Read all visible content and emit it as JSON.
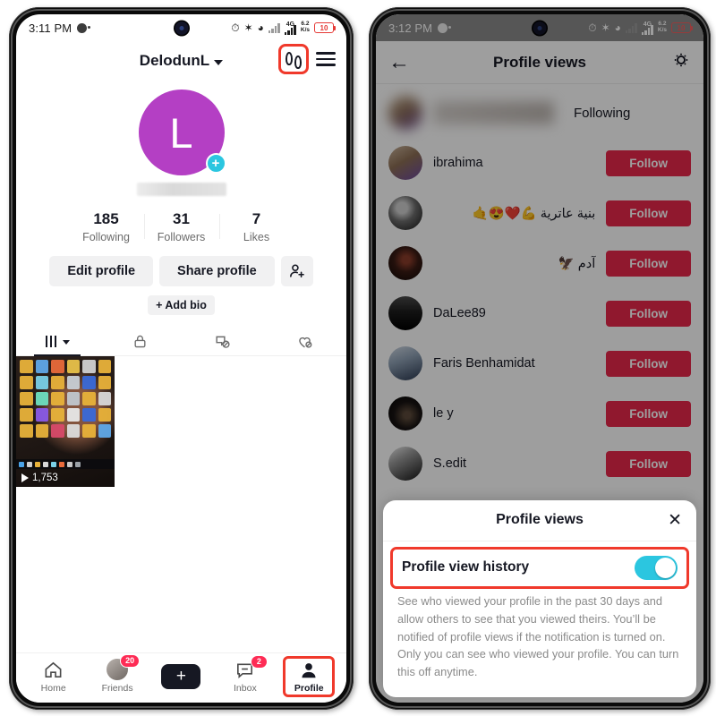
{
  "left_phone": {
    "status_bar": {
      "time": "3:11 PM",
      "alarm_icon": "alarm-icon",
      "bluetooth_icon": "bluetooth-icon",
      "hotspot_icon": "hotspot-icon",
      "network_type": "4G",
      "speed_value": "6.2",
      "speed_unit": "K/s",
      "battery": "10"
    },
    "header": {
      "username": "DelodunL",
      "dropdown_icon": "chevron-down-icon",
      "footprints_icon": "footprints-icon",
      "menu_icon": "hamburger-menu-icon"
    },
    "profile": {
      "avatar_letter": "L",
      "avatar_color": "#b43fc4",
      "add_story_icon": "plus-circle-icon",
      "handle_redacted": true,
      "stats": [
        {
          "num": "185",
          "label": "Following"
        },
        {
          "num": "31",
          "label": "Followers"
        },
        {
          "num": "7",
          "label": "Likes"
        }
      ],
      "edit_profile_label": "Edit profile",
      "share_profile_label": "Share profile",
      "add_friends_icon": "add-person-icon",
      "add_bio_label": "+ Add bio"
    },
    "content_tabs": [
      {
        "icon": "grid-videos-icon",
        "active": true
      },
      {
        "icon": "lock-private-icon",
        "active": false
      },
      {
        "icon": "repost-disabled-icon",
        "active": false
      },
      {
        "icon": "liked-hidden-icon",
        "active": false
      }
    ],
    "video": {
      "plays": "1,753",
      "play_icon": "play-icon"
    },
    "bottom_nav": [
      {
        "label": "Home",
        "icon": "home-icon",
        "badge": "",
        "active": false,
        "highlighted": false
      },
      {
        "label": "Friends",
        "icon": "friends-avatar-icon",
        "badge": "20",
        "active": false,
        "highlighted": false
      },
      {
        "label": "",
        "icon": "create-plus-icon",
        "badge": "",
        "active": false,
        "highlighted": false
      },
      {
        "label": "Inbox",
        "icon": "inbox-icon",
        "badge": "2",
        "active": false,
        "highlighted": false
      },
      {
        "label": "Profile",
        "icon": "profile-person-icon",
        "badge": "",
        "active": true,
        "highlighted": true
      }
    ]
  },
  "right_phone": {
    "status_bar": {
      "time": "3:12 PM",
      "network_type": "4G",
      "speed_value": "6.2",
      "speed_unit": "K/s",
      "battery": "10"
    },
    "header": {
      "back_icon": "arrow-left-icon",
      "title": "Profile views",
      "settings_icon": "gear-icon"
    },
    "viewers": [
      {
        "name": "",
        "redacted": true,
        "action": "Following",
        "action_type": "following",
        "avatar": "av1"
      },
      {
        "name": "ibrahima",
        "redacted": false,
        "action": "Follow",
        "action_type": "follow",
        "avatar": "av1",
        "rtl": false
      },
      {
        "name": "بنية عاترية 💪❤️😍🤙",
        "redacted": false,
        "action": "Follow",
        "action_type": "follow",
        "avatar": "av2",
        "rtl": true
      },
      {
        "name": "آدم 🦅",
        "redacted": false,
        "action": "Follow",
        "action_type": "follow",
        "avatar": "av3",
        "rtl": true
      },
      {
        "name": "DaLee89",
        "redacted": false,
        "action": "Follow",
        "action_type": "follow",
        "avatar": "av4",
        "rtl": false
      },
      {
        "name": "Faris Benhamidat",
        "redacted": false,
        "action": "Follow",
        "action_type": "follow",
        "avatar": "av5",
        "rtl": false
      },
      {
        "name": "le y",
        "redacted": false,
        "action": "Follow",
        "action_type": "follow",
        "avatar": "av6",
        "rtl": false
      },
      {
        "name": "S.edit",
        "redacted": false,
        "action": "Follow",
        "action_type": "follow",
        "avatar": "av7",
        "rtl": false
      }
    ],
    "sheet": {
      "title": "Profile views",
      "close_icon": "close-x-icon",
      "setting_label": "Profile view history",
      "toggle_on": true,
      "toggle_color": "#2bc6e0",
      "description": "See who viewed your profile in the past 30 days and allow others to see that you viewed theirs. You’ll be notified of profile views if the notification is turned on. Only you can see who viewed your profile. You can turn this off anytime."
    }
  },
  "annotations": {
    "highlight_color": "#f0392b"
  }
}
